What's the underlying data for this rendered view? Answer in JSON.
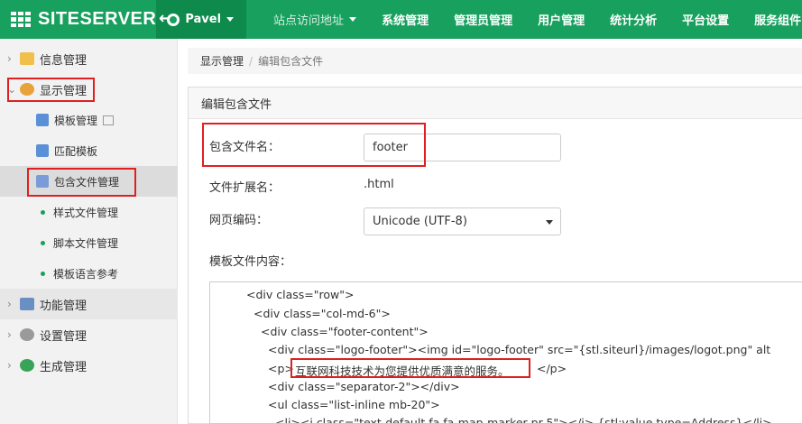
{
  "brand": {
    "name": "SITESERVER"
  },
  "topnav": {
    "user": "Pavel",
    "items": [
      "站点访问地址",
      "系统管理",
      "管理员管理",
      "用户管理",
      "统计分析",
      "平台设置",
      "服务组件"
    ]
  },
  "sidebar": {
    "items": [
      {
        "label": "信息管理"
      },
      {
        "label": "显示管理"
      },
      {
        "label": "模板管理"
      },
      {
        "label": "匹配模板"
      },
      {
        "label": "包含文件管理"
      },
      {
        "label": "样式文件管理"
      },
      {
        "label": "脚本文件管理"
      },
      {
        "label": "模板语言参考"
      },
      {
        "label": "功能管理"
      },
      {
        "label": "设置管理"
      },
      {
        "label": "生成管理"
      }
    ]
  },
  "breadcrumb": {
    "parent": "显示管理",
    "current": "编辑包含文件"
  },
  "panel": {
    "title": "编辑包含文件"
  },
  "form": {
    "filename_label": "包含文件名：",
    "filename_value": "footer",
    "ext_label": "文件扩展名：",
    "ext_value": ".html",
    "encoding_label": "网页编码：",
    "encoding_value": "Unicode (UTF-8)",
    "content_label": "模板文件内容："
  },
  "code": {
    "lines": [
      "<div class=\"row\">",
      "<div class=\"col-md-6\">",
      "<div class=\"footer-content\">",
      "<div class=\"logo-footer\"><img id=\"logo-footer\" src=\"{stl.siteurl}/images/logot.png\" alt",
      "<p>",
      "互联网科技技术为您提供优质满意的服务。",
      "</p>",
      "<div class=\"separator-2\"></div>",
      "<ul class=\"list-inline mb-20\">",
      "<li><i class=\"text-default fa fa-map-marker pr-5\"></i> {stl:value type=Address}</li>"
    ]
  },
  "colors": {
    "brand_green": "#17a05e",
    "highlight_red": "#e02020"
  }
}
